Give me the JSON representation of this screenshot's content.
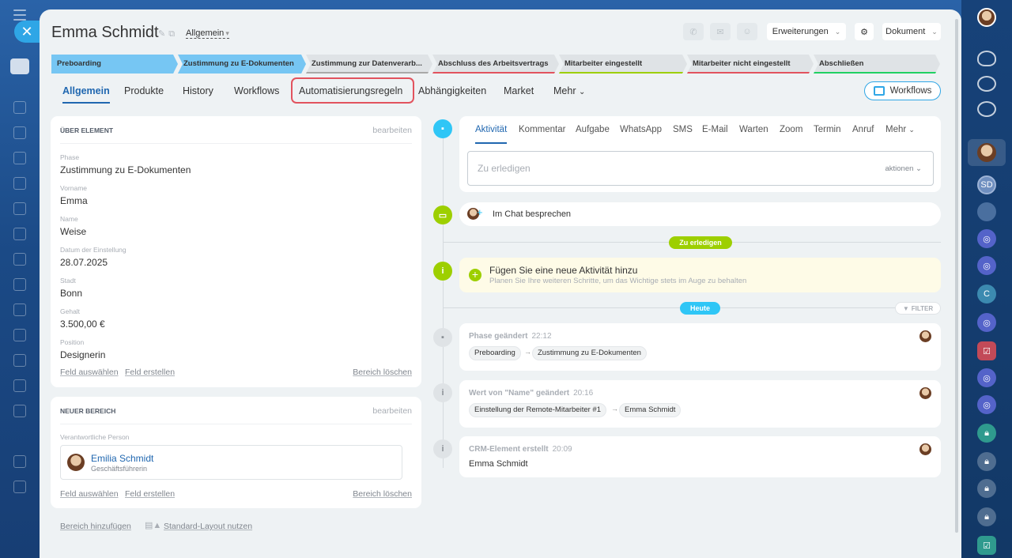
{
  "header": {
    "title": "Emma Schmidt",
    "category": "Allgemein",
    "buttons": {
      "extensions": "Erweiterungen",
      "document": "Dokument"
    }
  },
  "stages": [
    {
      "label": "Preboarding",
      "state": "done"
    },
    {
      "label": "Zustimmung zu E-Dokumenten",
      "state": "done"
    },
    {
      "label": "Zustimmung zur Datenverarb...",
      "state": "todo"
    },
    {
      "label": "Abschluss des Arbeitsvertrags",
      "state": "todo"
    },
    {
      "label": "Mitarbeiter eingestellt",
      "state": "todo"
    },
    {
      "label": "Mitarbeiter nicht eingestellt",
      "state": "todo"
    },
    {
      "label": "Abschließen",
      "state": "todo"
    }
  ],
  "stage_colors": [
    "#76c6f3",
    "#76c6f3",
    "#a9a9a9",
    "#e2535e",
    "#9dcf00",
    "#e2535e",
    "#21d163"
  ],
  "tabs": [
    "Allgemein",
    "Produkte",
    "History",
    "Workflows",
    "Automatisierungsregeln",
    "Abhängigkeiten",
    "Market",
    "Mehr"
  ],
  "workflows_button": "Workflows",
  "about_card": {
    "title": "ÜBER ELEMENT",
    "edit": "bearbeiten",
    "fields": [
      {
        "label": "Phase",
        "value": "Zustimmung zu E-Dokumenten"
      },
      {
        "label": "Vorname",
        "value": "Emma"
      },
      {
        "label": "Name",
        "value": "Weise"
      },
      {
        "label": "Datum der Einstellung",
        "value": "28.07.2025"
      },
      {
        "label": "Stadt",
        "value": "Bonn"
      },
      {
        "label": "Gehalt",
        "value": "3.500,00 €"
      },
      {
        "label": "Position",
        "value": "Designerin"
      }
    ],
    "select_field": "Feld auswählen",
    "create_field": "Feld erstellen",
    "delete_section": "Bereich löschen"
  },
  "new_section_card": {
    "title": "NEUER BEREICH",
    "edit": "bearbeiten",
    "responsible_label": "Verantwortliche Person",
    "person_name": "Emilia Schmidt",
    "person_role": "Geschäftsführerin",
    "select_field": "Feld auswählen",
    "create_field": "Feld erstellen",
    "delete_section": "Bereich löschen"
  },
  "bottom": {
    "add_section": "Bereich hinzufügen",
    "standard_layout": "Standard-Layout nutzen"
  },
  "activity": {
    "tabs": [
      "Aktivität",
      "Kommentar",
      "Aufgabe",
      "WhatsApp",
      "SMS",
      "E-Mail",
      "Warten",
      "Zoom",
      "Termin",
      "Anruf",
      "Mehr"
    ],
    "input_placeholder": "Zu erledigen",
    "actions": "aktionen"
  },
  "chat": "Im Chat besprechen",
  "todo_pill": "Zu erledigen",
  "new_activity": {
    "title": "Fügen Sie eine neue Aktivität hinzu",
    "subtitle": "Planen Sie Ihre weiteren Schritte, um das Wichtige stets im Auge zu behalten"
  },
  "today_pill": "Heute",
  "filter": "FILTER",
  "events": [
    {
      "title": "Phase geändert",
      "time": "22:12",
      "from": "Preboarding",
      "to": "Zustimmung zu E-Dokumenten"
    },
    {
      "title": "Wert von \"Name\" geändert",
      "time": "20:16",
      "from": "Einstellung der Remote-Mitarbeiter #1",
      "to": "Emma Schmidt"
    },
    {
      "title": "CRM-Element erstellt",
      "time": "20:09",
      "text": "Emma Schmidt"
    }
  ],
  "rightbar_badge": "SD",
  "rightbar_letter": "C"
}
